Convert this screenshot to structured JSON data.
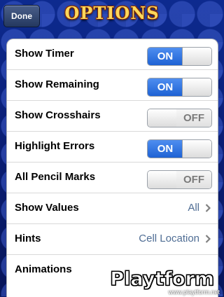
{
  "header": {
    "done_label": "Done",
    "title": "OPTIONS"
  },
  "options": [
    {
      "label": "Show Timer",
      "type": "switch",
      "state": "ON"
    },
    {
      "label": "Show Remaining",
      "type": "switch",
      "state": "ON"
    },
    {
      "label": "Show Crosshairs",
      "type": "switch",
      "state": "OFF"
    },
    {
      "label": "Highlight Errors",
      "type": "switch",
      "state": "ON"
    },
    {
      "label": "All Pencil Marks",
      "type": "switch",
      "state": "OFF"
    },
    {
      "label": "Show Values",
      "type": "disclosure",
      "value": "All"
    },
    {
      "label": "Hints",
      "type": "disclosure",
      "value": "Cell Location"
    },
    {
      "label": "Animations",
      "type": "partial"
    }
  ],
  "switch_labels": {
    "on": "ON",
    "off": "OFF"
  },
  "watermark": {
    "logo_text": "Playtform",
    "url": "www.playtform.net"
  },
  "colors": {
    "accent_on": "#1e62d4",
    "title": "#ffd75a",
    "detail_value": "#4f6d94"
  }
}
